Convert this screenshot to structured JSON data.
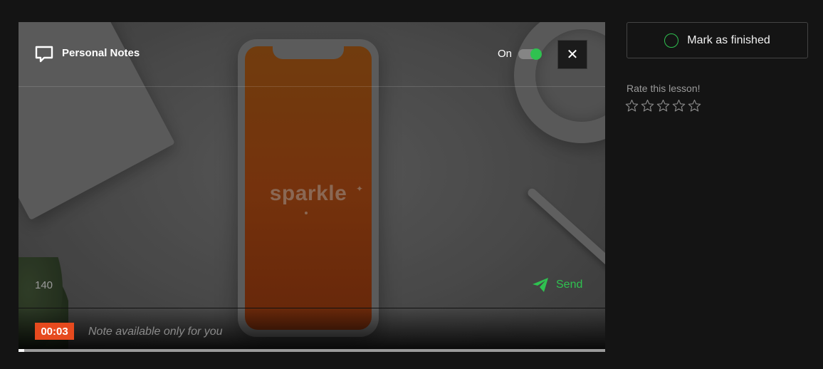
{
  "player": {
    "brand_text": "sparkle",
    "brand_mark": "✦",
    "notes": {
      "title": "Personal Notes",
      "icon": "comment-icon",
      "toggle_label": "On",
      "toggle_on": true,
      "close_icon": "close-icon",
      "char_count": "140",
      "send_label": "Send",
      "send_icon": "paper-plane-icon",
      "timestamp": "00:03",
      "placeholder": "Note available only for you"
    },
    "progress": 0.01,
    "accent": "#2fc150",
    "timestamp_color": "#e64a1e"
  },
  "sidebar": {
    "mark_finished_label": "Mark as finished",
    "rate_label": "Rate this lesson!",
    "stars_total": 5,
    "stars_selected": 0
  }
}
